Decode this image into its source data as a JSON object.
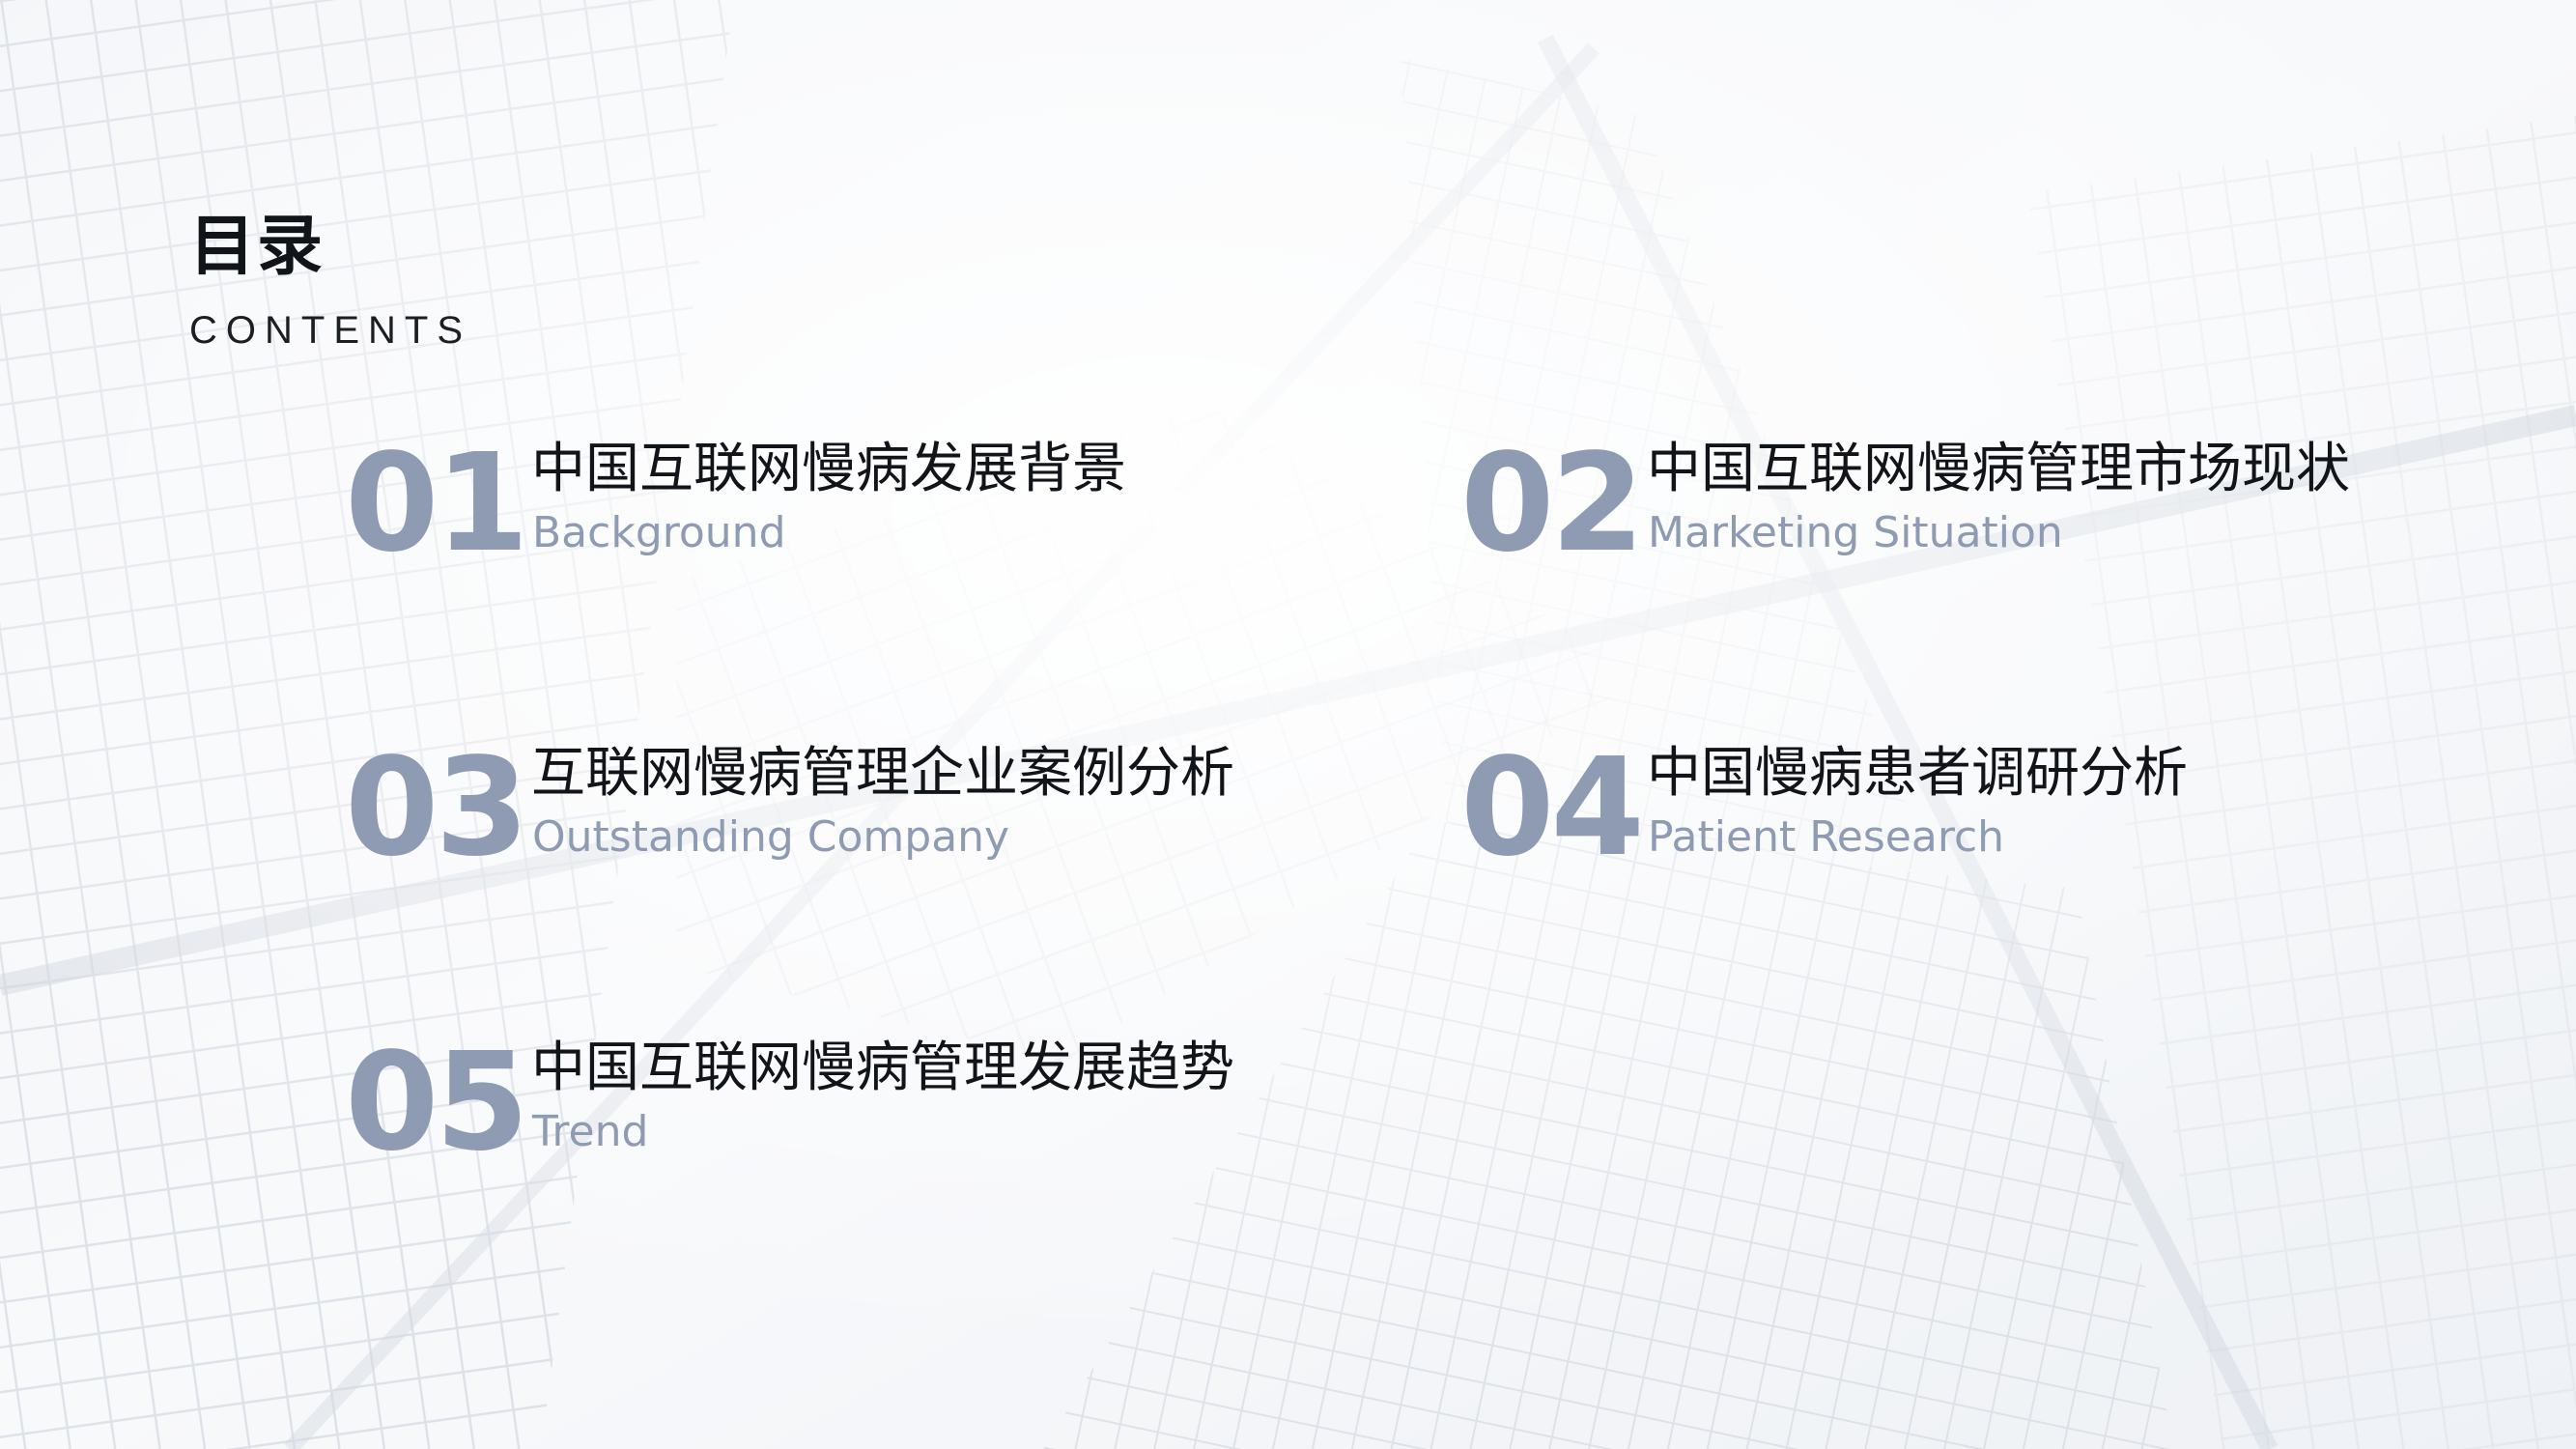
{
  "heading": {
    "title": "目录",
    "subtitle": "CONTENTS"
  },
  "items": [
    {
      "number": "01",
      "title": "中国互联网慢病发展背景",
      "subtitle": "Background"
    },
    {
      "number": "02",
      "title": "中国互联网慢病管理市场现状",
      "subtitle": "Marketing Situation"
    },
    {
      "number": "03",
      "title": "互联网慢病管理企业案例分析",
      "subtitle": "Outstanding Company"
    },
    {
      "number": "04",
      "title": "中国慢病患者调研分析",
      "subtitle": "Patient Research"
    },
    {
      "number": "05",
      "title": "中国互联网慢病管理发展趋势",
      "subtitle": "Trend"
    }
  ],
  "colors": {
    "accent": "#8e9bb3",
    "text": "#111418"
  }
}
